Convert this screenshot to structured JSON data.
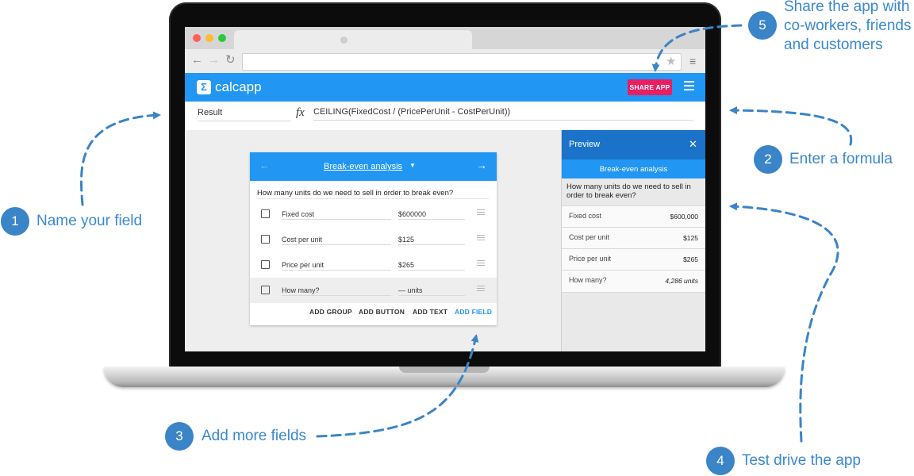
{
  "browser": {
    "url": ""
  },
  "app": {
    "brand": "calcapp",
    "logo_glyph": "Σ",
    "share_label": "SHARE APP",
    "formula_bar": {
      "field_name": "Result",
      "fx_symbol": "fx",
      "formula": "CEILING(FixedCost / (PricePerUnit - CostPerUnit))"
    },
    "editor": {
      "title": "Break-even analysis",
      "question": "How many units do we need to sell in order to break even?",
      "fields": [
        {
          "label": "Fixed cost",
          "value": "$600000"
        },
        {
          "label": "Cost per unit",
          "value": "$125"
        },
        {
          "label": "Price per unit",
          "value": "$265"
        },
        {
          "label": "How many?",
          "value": "— units"
        }
      ],
      "actions": {
        "add_group": "ADD GROUP",
        "add_button": "ADD BUTTON",
        "add_text": "ADD TEXT",
        "add_field": "ADD FIELD"
      }
    },
    "preview": {
      "title": "Preview",
      "card_title": "Break-even analysis",
      "question": "How many units do we need to sell in order to break even?",
      "rows": [
        {
          "label": "Fixed cost",
          "value": "$600,000"
        },
        {
          "label": "Cost per unit",
          "value": "$125"
        },
        {
          "label": "Price per unit",
          "value": "$265"
        },
        {
          "label": "How many?",
          "value": "4,286 units"
        }
      ]
    }
  },
  "annotations": [
    {
      "number": "1",
      "text": "Name your field"
    },
    {
      "number": "2",
      "text": "Enter a formula"
    },
    {
      "number": "3",
      "text": "Add more fields"
    },
    {
      "number": "4",
      "text": "Test drive the app"
    },
    {
      "number": "5",
      "text_lines": [
        "Share the app with",
        "co-workers, friends",
        "and customers"
      ]
    }
  ],
  "colors": {
    "accent": "#2196f3",
    "share": "#e91e63",
    "annotation": "#3a84c8"
  }
}
